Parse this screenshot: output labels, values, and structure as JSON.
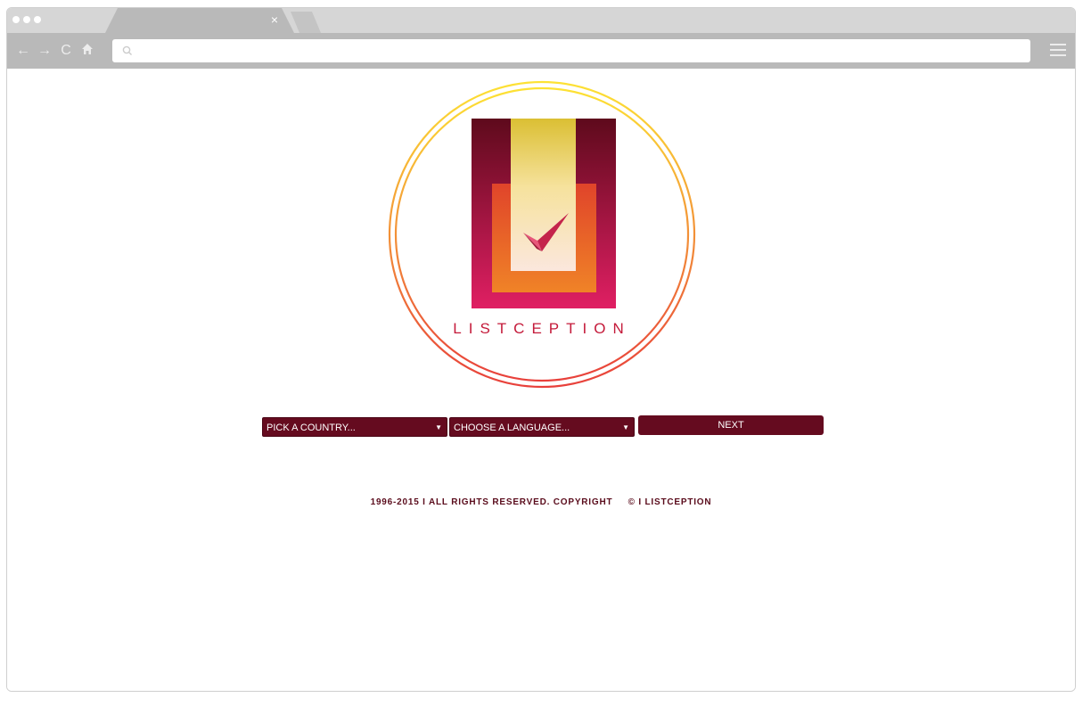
{
  "browser": {
    "tab_close": "×",
    "nav": {
      "back": "←",
      "forward": "→",
      "reload": "C"
    },
    "address_value": ""
  },
  "logo": {
    "wordmark": "LISTCEPTION",
    "colors": {
      "ring_top": "#fde234",
      "ring_bottom": "#e8403b",
      "outer_top": "#5e0a1c",
      "outer_bottom": "#e01f63",
      "middle_top": "#e0442a",
      "middle_bottom": "#f08327",
      "inner_top": "#dbbf33",
      "wordmark": "#c41a3a"
    }
  },
  "form": {
    "country_select": "PICK A COUNTRY...",
    "language_select": "CHOOSE A LANGUAGE...",
    "select_arrow": "▼",
    "next_button": "NEXT"
  },
  "footer": {
    "text": "1996-2015 I ALL RIGHTS RESERVED. COPYRIGHT",
    "brand": "© I LISTCEPTION"
  }
}
